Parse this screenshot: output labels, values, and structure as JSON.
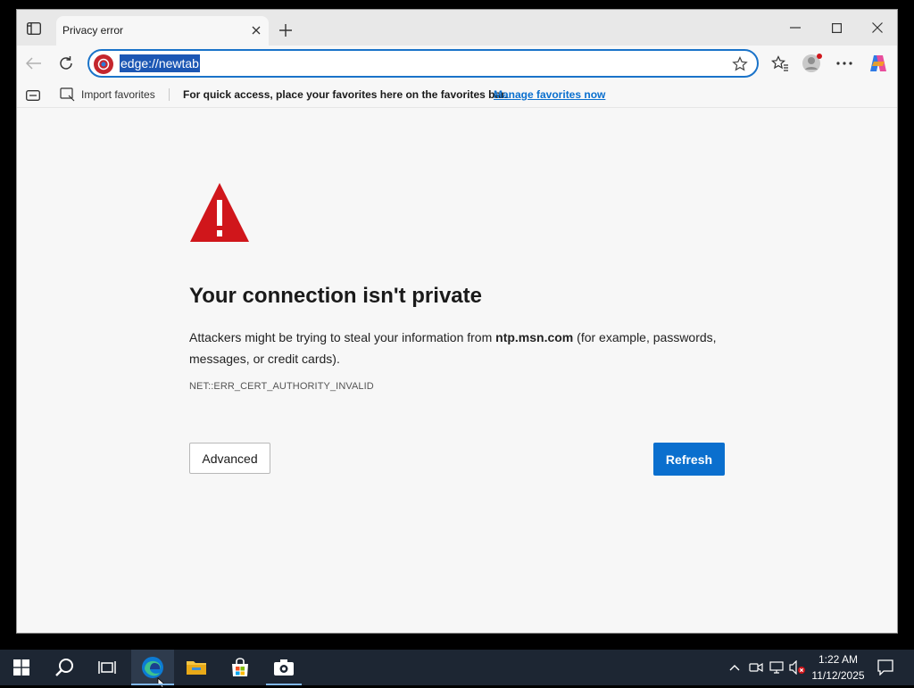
{
  "browser": {
    "tab_title": "Privacy error",
    "url": "edge://newtab",
    "favorites_bar": {
      "import_label": "Import favorites",
      "message": "For quick access, place your favorites here on the favorites bar.",
      "manage_link": "Manage favorites now"
    }
  },
  "error_page": {
    "heading": "Your connection isn't private",
    "para_before": "Attackers might be trying to steal your information from ",
    "host": "ntp.msn.com",
    "para_after": " (for example, passwords, messages, or credit cards).",
    "error_code": "NET::ERR_CERT_AUTHORITY_INVALID",
    "advanced_label": "Advanced",
    "refresh_label": "Refresh",
    "warning_color": "#d0161b",
    "button_color": "#0a6fce"
  },
  "taskbar": {
    "time": "1:22 AM",
    "date": "11/12/2025",
    "apps": [
      "start-icon",
      "search-icon",
      "task-view-icon",
      "edge-icon",
      "file-explorer-icon",
      "store-icon",
      "camera-app-icon"
    ]
  }
}
